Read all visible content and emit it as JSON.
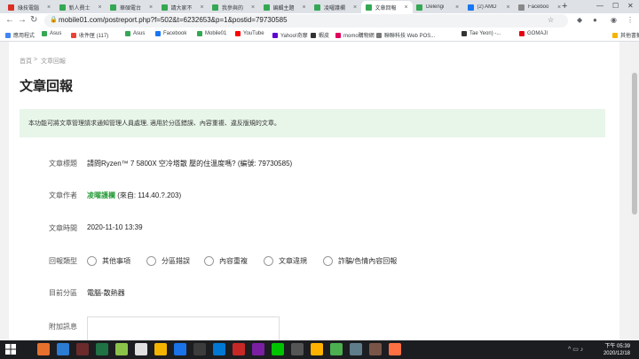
{
  "browser": {
    "tabs": [
      {
        "title": "綠技電腦",
        "color": "#d93025"
      },
      {
        "title": "新人費士",
        "color": "#34a853"
      },
      {
        "title": "華碩電台",
        "color": "#34a853"
      },
      {
        "title": "請大家不",
        "color": "#34a853"
      },
      {
        "title": "我參與的",
        "color": "#34a853"
      },
      {
        "title": "編輯主題",
        "color": "#34a853"
      },
      {
        "title": "凌曜護欄",
        "color": "#34a853"
      },
      {
        "title": "文章回報",
        "color": "#34a853",
        "active": true
      },
      {
        "title": "Delengi",
        "color": "#34a853"
      },
      {
        "title": "(2) AMD",
        "color": "#1877f2"
      },
      {
        "title": "Faceboo",
        "color": "#888888"
      }
    ],
    "url": "mobile01.com/postreport.php?f=502&t=6232653&p=1&postid=79730585",
    "bookmarks": [
      {
        "label": "應用程式",
        "color": "#4285f4"
      },
      {
        "label": "Asus",
        "color": "#34a853"
      },
      {
        "label": "收件匣 (117)",
        "color": "#ea4335"
      },
      {
        "label": "Asus",
        "color": "#34a853"
      },
      {
        "label": "Facebook",
        "color": "#1877f2"
      },
      {
        "label": "Mobile01",
        "color": "#34a853"
      },
      {
        "label": "YouTube",
        "color": "#ff0000"
      },
      {
        "label": "Yahoo!奇摩",
        "color": "#5f01d1"
      },
      {
        "label": "蝦皮",
        "color": "#333333"
      },
      {
        "label": "momo購物網",
        "color": "#e1005e"
      },
      {
        "label": "聯聯科技 Web POS...",
        "color": "#777777"
      },
      {
        "label": " Tae Yeon) -...",
        "color": "#333333"
      },
      {
        "label": "GOMAJI",
        "color": "#e60012"
      },
      {
        "label": "其他書籤",
        "color": "#f4b400"
      }
    ]
  },
  "page": {
    "breadcrumb": {
      "home": "首頁",
      "sep": ">",
      "current": "文章回報"
    },
    "heading": "文章回報",
    "notice": "本功能可將文章管理請求通知管理人員處理, 適用於分區錯誤、內容重複、違反版規的文章。",
    "fields": {
      "title_label": "文章標題",
      "title_value": "請問Ryzen™ 7 5800X 空冷塔散 壓的住溫度嗎? (編號: 79730585)",
      "author_label": "文章作者",
      "author_name": "凌曜護欄",
      "author_ip": " (來自: 114.40.?.203)",
      "time_label": "文章時間",
      "time_value": "2020-11-10 13:39",
      "type_label": "回報類型",
      "types": [
        "其他事項",
        "分區錯誤",
        "內容重複",
        "文章違規",
        "詐騙/色情內容回報"
      ],
      "forum_label": "目前分區",
      "forum_value": "電腦-散熱器",
      "extra_label": "附加訊息"
    }
  },
  "taskbar": {
    "time": "下午 05:39",
    "date": "2020/12/18",
    "apps": [
      "#e6702e",
      "#2b7cd3",
      "#6b2b2b",
      "#1f7244",
      "#8bc34a",
      "#e0e0e0",
      "#f4b400",
      "#1a73e8",
      "#3c3c3c",
      "#0078d4",
      "#c62828",
      "#7b1fa2",
      "#00c300",
      "#555555",
      "#ffb300",
      "#4caf50",
      "#607d8b",
      "#795548",
      "#ff7043"
    ]
  }
}
